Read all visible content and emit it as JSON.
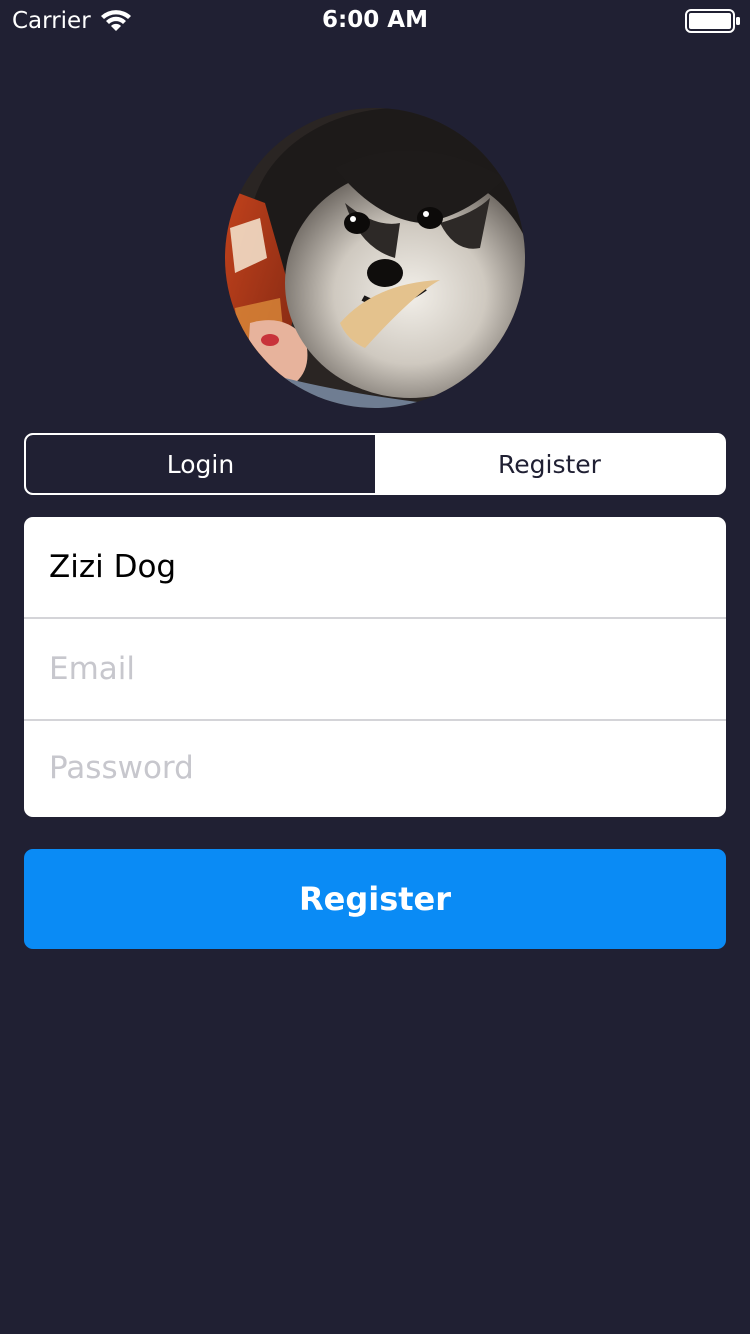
{
  "status_bar": {
    "carrier": "Carrier",
    "time": "6:00 AM",
    "wifi_icon": "wifi-icon",
    "battery_icon": "battery-icon"
  },
  "avatar": {
    "description_icon": "profile-photo"
  },
  "auth_mode": {
    "login_label": "Login",
    "register_label": "Register",
    "selected": "Login"
  },
  "form": {
    "name_value": "Zizi Dog",
    "email_placeholder": "Email",
    "email_value": "",
    "password_placeholder": "Password",
    "password_value": ""
  },
  "submit": {
    "label": "Register"
  },
  "colors": {
    "background": "#202033",
    "accent": "#0a8bf5",
    "surface": "#ffffff",
    "placeholder": "#c7c7cd"
  }
}
